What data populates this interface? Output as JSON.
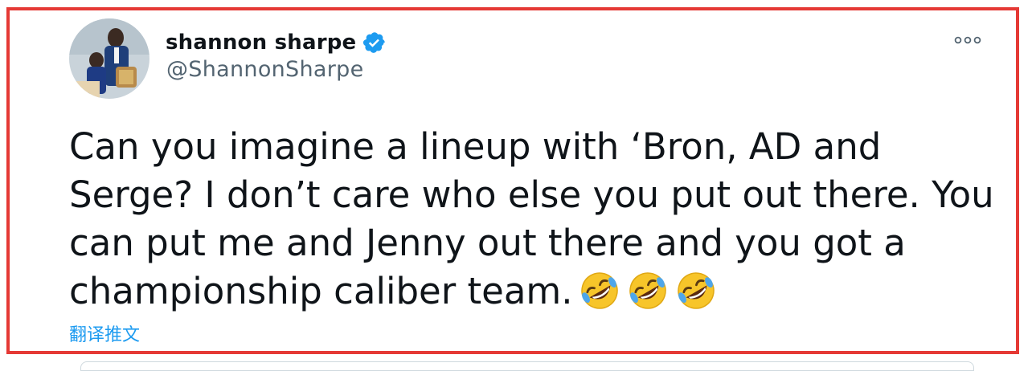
{
  "tweet": {
    "author": {
      "display_name": "shannon sharpe",
      "handle": "@ShannonSharpe",
      "verified": true,
      "verified_icon": "verified-badge-icon",
      "avatar": "avatar-photo"
    },
    "more_icon": "more-horizontal-icon",
    "text_lines": [
      "Can you imagine a lineup with ‘Bron, AD and",
      "Serge? I don’t care who else you put out there. You",
      "can put me and Jenny out there and you got a",
      "championship caliber team."
    ],
    "emojis": [
      "rolling-on-floor-laughing-icon",
      "rolling-on-floor-laughing-icon",
      "rolling-on-floor-laughing-icon"
    ],
    "translate_label": "翻译推文"
  },
  "colors": {
    "highlight_border": "#e53935",
    "link": "#1d9bf0",
    "text_primary": "#0f1419",
    "text_secondary": "#536471",
    "verified": "#1d9bf0"
  }
}
